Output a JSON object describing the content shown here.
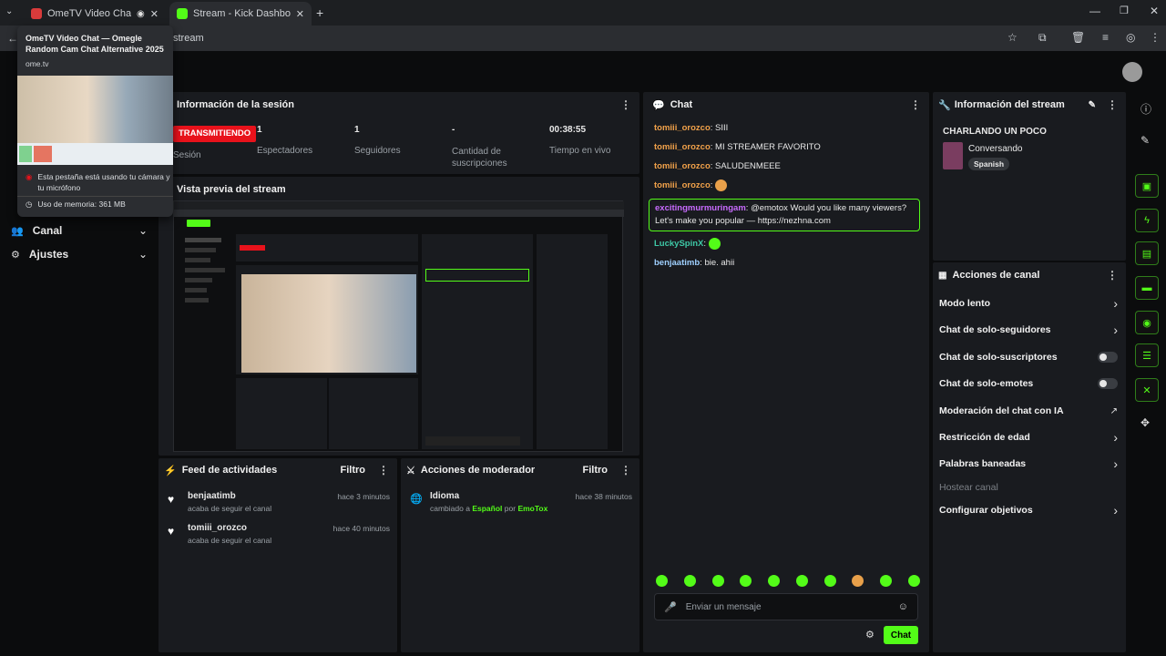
{
  "browser": {
    "tabs": [
      {
        "title": "OmeTV Video Chat — Ome",
        "active": false
      },
      {
        "title": "Stream - Kick Dashboard",
        "active": true
      }
    ],
    "address": "stream",
    "tooltip": {
      "title": "OmeTV Video Chat — Omegle Random Cam Chat Alternative 2025",
      "domain": "ome.tv",
      "camera_note": "Esta pestaña está usando tu cámara y tu micrófono",
      "memory": "Uso de memoria: 361 MB"
    }
  },
  "sidebar": {
    "items": [
      {
        "label": "Canal"
      },
      {
        "label": "Ajustes"
      }
    ]
  },
  "session": {
    "title": "Información de la sesión",
    "live_badge": "TRANSMITIENDO",
    "sub": "Sesión",
    "stats": [
      {
        "value": "1",
        "label": "Espectadores"
      },
      {
        "value": "1",
        "label": "Seguidores"
      },
      {
        "value": "-",
        "label": "Cantidad de suscripciones"
      },
      {
        "value": "00:38:55",
        "label": "Tiempo en vivo"
      }
    ]
  },
  "preview": {
    "title": "Vista previa del stream"
  },
  "activity": {
    "title": "Feed de actividades",
    "filter": "Filtro",
    "items": [
      {
        "user": "benjaatimb",
        "action": "acaba de seguir el canal",
        "time": "hace 3 minutos"
      },
      {
        "user": "tomiii_orozco",
        "action": "acaba de seguir el canal",
        "time": "hace 40 minutos"
      }
    ]
  },
  "moderator": {
    "title": "Acciones de moderador",
    "filter": "Filtro",
    "items": [
      {
        "title": "Idioma",
        "prefix": "cambiado a",
        "value": "Español",
        "by": "por",
        "user": "EmoTox",
        "time": "hace 38 minutos"
      }
    ]
  },
  "chat": {
    "title": "Chat",
    "messages": [
      {
        "user": "tomiii_orozco",
        "text": "SIII"
      },
      {
        "user": "tomiii_orozco",
        "text": "MI STREAMER FAVORITO"
      },
      {
        "user": "tomiii_orozco",
        "text": "SALUDENMEEE"
      },
      {
        "user": "tomiii_orozco",
        "text": ""
      },
      {
        "user": "excitingmurmuringam",
        "text": "@emotox Would you like many viewers? Let's make you popular — https://nezhna.com"
      },
      {
        "user": "LuckySpinX",
        "text": ""
      },
      {
        "user": "benjaatimb",
        "text": "bie. ahii"
      }
    ],
    "input_placeholder": "Enviar un mensaje",
    "send_label": "Chat"
  },
  "stream_info": {
    "title": "Información del stream",
    "stream_title": "CHARLANDO UN POCO",
    "category": "Conversando",
    "tag": "Spanish"
  },
  "channel_actions": {
    "title": "Acciones de canal",
    "items": [
      {
        "label": "Modo lento",
        "control": "chevron"
      },
      {
        "label": "Chat de solo-seguidores",
        "control": "chevron"
      },
      {
        "label": "Chat de solo-suscriptores",
        "control": "toggle"
      },
      {
        "label": "Chat de solo-emotes",
        "control": "toggle"
      },
      {
        "label": "Moderación del chat con IA",
        "control": "external"
      },
      {
        "label": "Restricción de edad",
        "control": "chevron"
      },
      {
        "label": "Palabras baneadas",
        "control": "chevron"
      },
      {
        "label": "Hostear canal",
        "control": "none",
        "disabled": true
      },
      {
        "label": "Configurar objetivos",
        "control": "chevron"
      }
    ]
  },
  "colors": {
    "accent": "#53fc18",
    "live": "#e8121b",
    "panel": "#191b1f"
  }
}
